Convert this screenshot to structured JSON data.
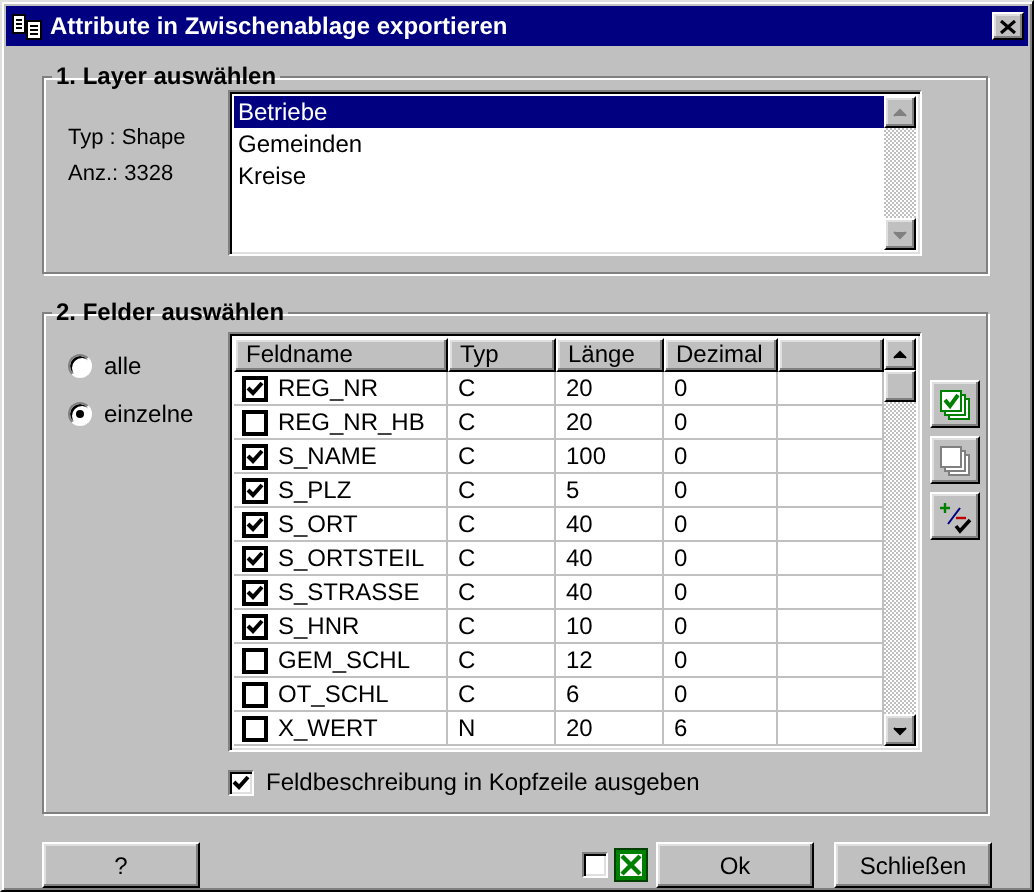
{
  "window": {
    "title": "Attribute in Zwischenablage exportieren"
  },
  "layer_group": {
    "title": "1. Layer auswählen",
    "type_label": "Typ : Shape",
    "count_label": "Anz.: 3328",
    "layers": [
      {
        "label": "Betriebe",
        "selected": true
      },
      {
        "label": "Gemeinden",
        "selected": false
      },
      {
        "label": "Kreise",
        "selected": false
      }
    ]
  },
  "fields_group": {
    "title": "2. Felder auswählen",
    "options": [
      {
        "label": "alle",
        "selected": false
      },
      {
        "label": "einzelne",
        "selected": true
      }
    ],
    "columns": [
      "Feldname",
      "Typ",
      "Länge",
      "Dezimal"
    ],
    "rows": [
      {
        "name": "REG_NR",
        "checked": true,
        "type": "C",
        "length": "20",
        "decimal": "0"
      },
      {
        "name": "REG_NR_HB",
        "checked": false,
        "type": "C",
        "length": "20",
        "decimal": "0"
      },
      {
        "name": "S_NAME",
        "checked": true,
        "type": "C",
        "length": "100",
        "decimal": "0"
      },
      {
        "name": "S_PLZ",
        "checked": true,
        "type": "C",
        "length": "5",
        "decimal": "0"
      },
      {
        "name": "S_ORT",
        "checked": true,
        "type": "C",
        "length": "40",
        "decimal": "0"
      },
      {
        "name": "S_ORTSTEIL",
        "checked": true,
        "type": "C",
        "length": "40",
        "decimal": "0"
      },
      {
        "name": "S_STRASSE",
        "checked": true,
        "type": "C",
        "length": "40",
        "decimal": "0"
      },
      {
        "name": "S_HNR",
        "checked": true,
        "type": "C",
        "length": "10",
        "decimal": "0"
      },
      {
        "name": "GEM_SCHL",
        "checked": false,
        "type": "C",
        "length": "12",
        "decimal": "0"
      },
      {
        "name": "OT_SCHL",
        "checked": false,
        "type": "C",
        "length": "6",
        "decimal": "0"
      },
      {
        "name": "X_WERT",
        "checked": false,
        "type": "N",
        "length": "20",
        "decimal": "6"
      }
    ],
    "header_option": {
      "label": "Feldbeschreibung in Kopfzeile ausgeben",
      "checked": true
    }
  },
  "footer": {
    "help_button": "?",
    "excel_export": {
      "checked": false
    },
    "buttons": [
      "Ok",
      "Schließen"
    ]
  }
}
